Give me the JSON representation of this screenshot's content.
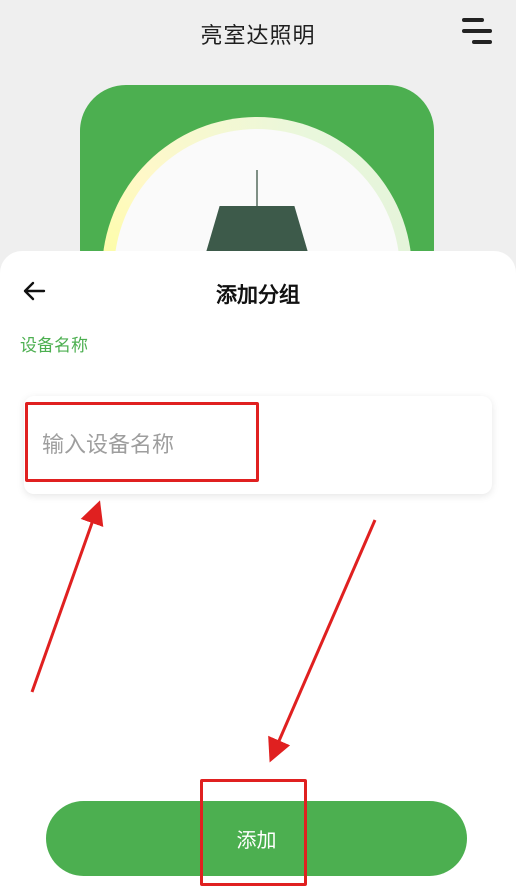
{
  "header": {
    "title": "亮室达照明",
    "menu_icon": "menu-icon"
  },
  "device_preview": {
    "lamp_icon": "pendant-lamp-icon",
    "card_color": "#4caf50"
  },
  "sheet": {
    "back_icon": "back-arrow-icon",
    "title": "添加分组",
    "field_label": "设备名称",
    "input": {
      "placeholder": "输入设备名称",
      "value": ""
    },
    "submit_label": "添加"
  },
  "colors": {
    "accent": "#4caf50",
    "annotation": "#e02020",
    "background": "#efefef"
  }
}
